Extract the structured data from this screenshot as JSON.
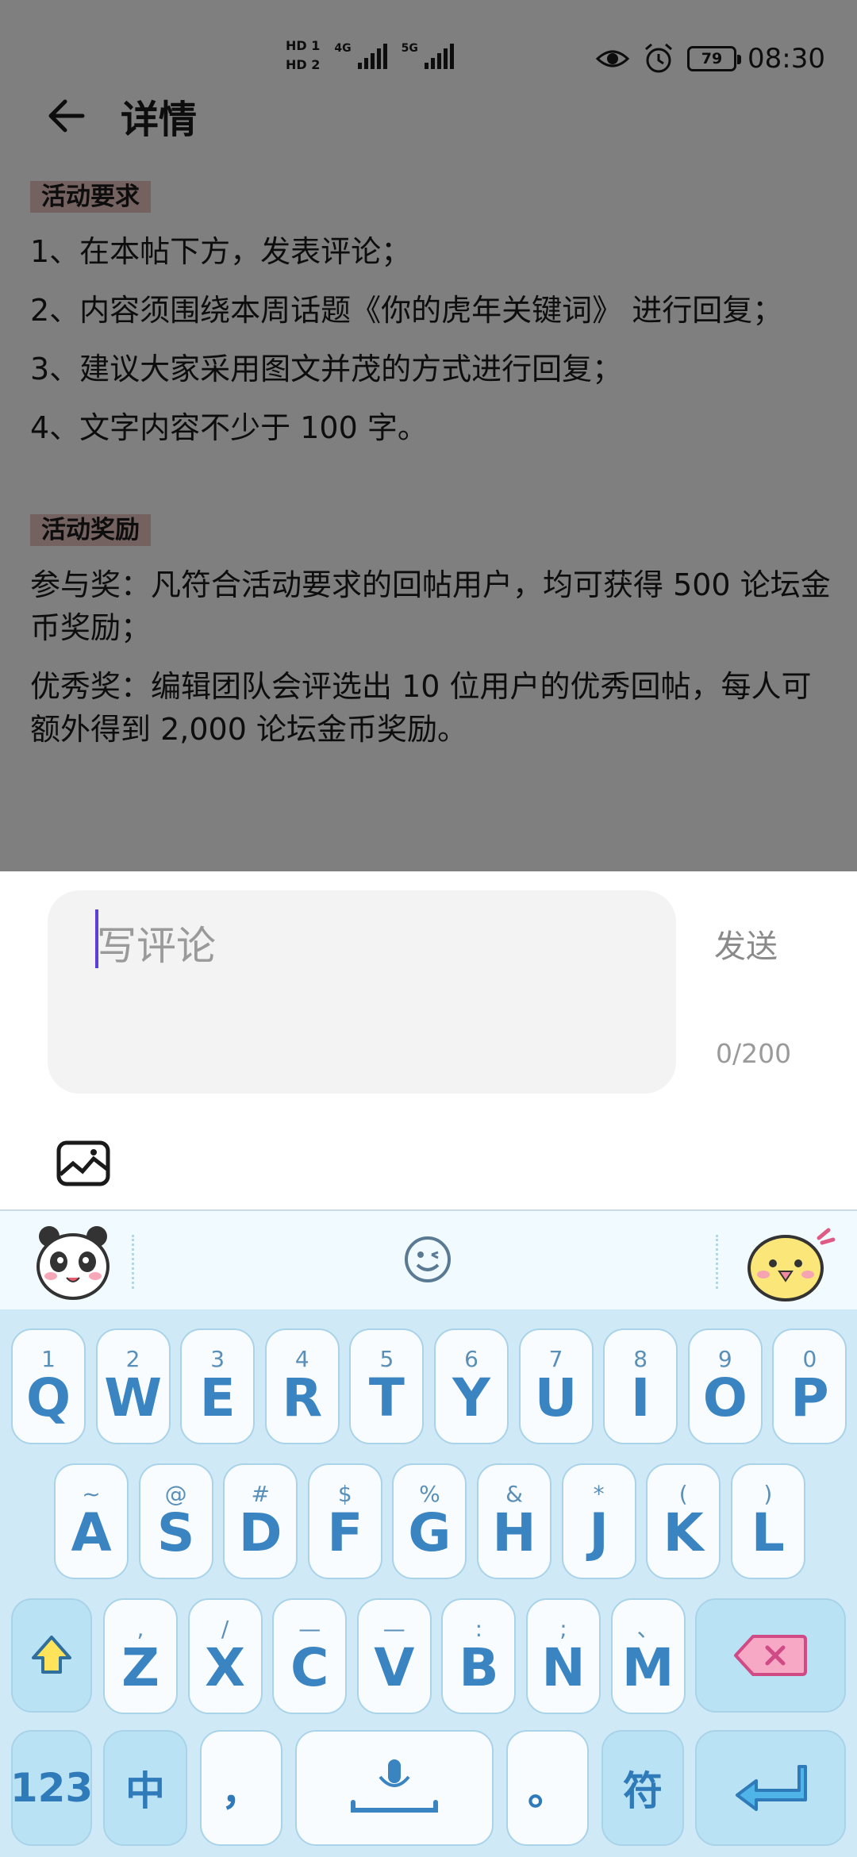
{
  "status_bar": {
    "hd1": "HD 1",
    "hd2": "HD 2",
    "net1": "4G",
    "net2": "5G",
    "battery": "79",
    "time": "08:30"
  },
  "header": {
    "title": "详情"
  },
  "article": {
    "section1_tag": "活动要求",
    "req1": "1、在本帖下方，发表评论；",
    "req2": "2、内容须围绕本周话题《你的虎年关键词》 进行回复；",
    "req3": "3、建议大家采用图文并茂的方式进行回复；",
    "req4": "4、文字内容不少于 100 字。",
    "section2_tag": "活动奖励",
    "reward1": "参与奖：凡符合活动要求的回帖用户，均可获得 500 论坛金币奖励；",
    "reward2": "优秀奖：编辑团队会评选出 10 位用户的优秀回帖，每人可额外得到 2,000 论坛金币奖励。"
  },
  "comment": {
    "placeholder": "写评论",
    "send_label": "发送",
    "counter": "0/200"
  },
  "keyboard": {
    "row1": [
      {
        "sub": "1",
        "key": "Q"
      },
      {
        "sub": "2",
        "key": "W"
      },
      {
        "sub": "3",
        "key": "E"
      },
      {
        "sub": "4",
        "key": "R"
      },
      {
        "sub": "5",
        "key": "T"
      },
      {
        "sub": "6",
        "key": "Y"
      },
      {
        "sub": "7",
        "key": "U"
      },
      {
        "sub": "8",
        "key": "I"
      },
      {
        "sub": "9",
        "key": "O"
      },
      {
        "sub": "0",
        "key": "P"
      }
    ],
    "row2": [
      {
        "sub": "~",
        "key": "A"
      },
      {
        "sub": "@",
        "key": "S"
      },
      {
        "sub": "#",
        "key": "D"
      },
      {
        "sub": "$",
        "key": "F"
      },
      {
        "sub": "%",
        "key": "G"
      },
      {
        "sub": "&",
        "key": "H"
      },
      {
        "sub": "*",
        "key": "J"
      },
      {
        "sub": "(",
        "key": "K"
      },
      {
        "sub": ")",
        "key": "L"
      }
    ],
    "row3": [
      {
        "sub": ",",
        "key": "Z"
      },
      {
        "sub": "/",
        "key": "X"
      },
      {
        "sub": "—",
        "key": "C"
      },
      {
        "sub": "—",
        "key": "V"
      },
      {
        "sub": ":",
        "key": "B"
      },
      {
        "sub": ";",
        "key": "N"
      },
      {
        "sub": "、",
        "key": "M"
      }
    ],
    "num_label": "123",
    "lang_label": "中",
    "comma_label": "，",
    "period_label": "。",
    "symbol_label": "符"
  }
}
